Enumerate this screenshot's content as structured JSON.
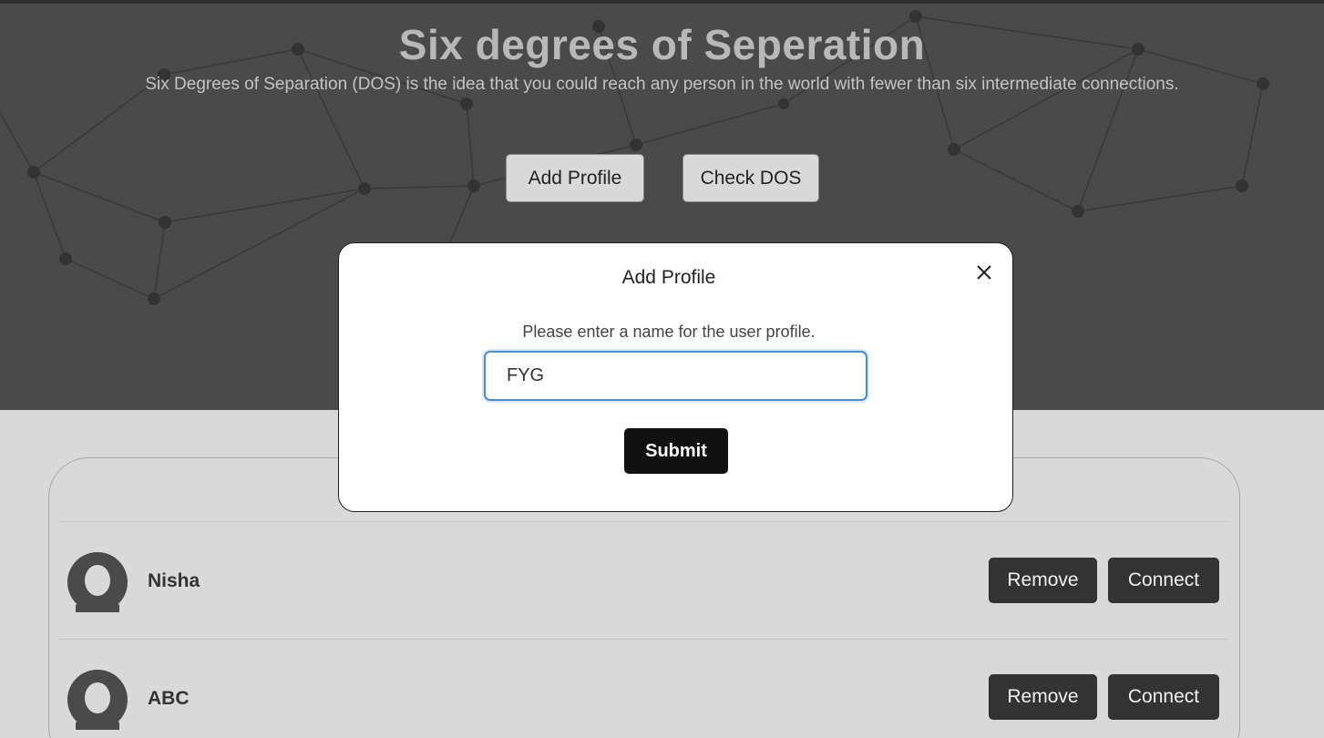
{
  "header": {
    "title": "Six degrees of Seperation",
    "subtitle": "Six Degrees of Separation (DOS) is the idea that you could reach any person in the world with fewer than six intermediate connections.",
    "add_profile_label": "Add Profile",
    "check_dos_label": "Check DOS"
  },
  "modal": {
    "title": "Add Profile",
    "prompt": "Please enter a name for the user profile.",
    "input_value": "FYG",
    "submit_label": "Submit",
    "close_icon": "close-icon"
  },
  "profiles": [
    {
      "name": "Nisha",
      "remove_label": "Remove",
      "connect_label": "Connect"
    },
    {
      "name": "ABC",
      "remove_label": "Remove",
      "connect_label": "Connect"
    }
  ],
  "colors": {
    "hero_bg": "#4a4a4a",
    "page_bg": "#d9d9d9",
    "button_dark": "#333333",
    "submit_bg": "#111111",
    "input_focus": "#4a8fd6"
  }
}
